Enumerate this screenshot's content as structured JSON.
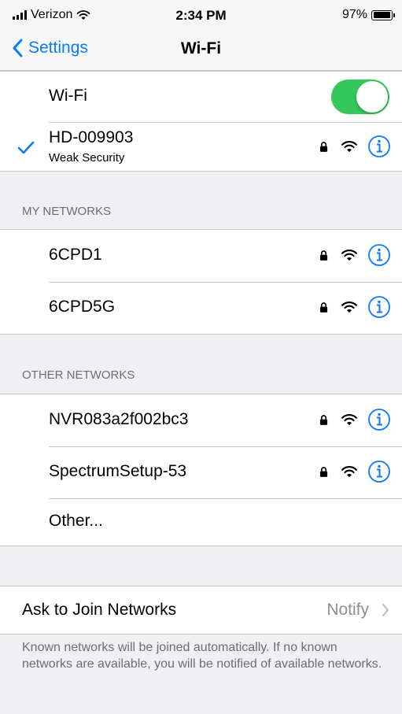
{
  "status_bar": {
    "carrier": "Verizon",
    "time": "2:34 PM",
    "battery": "97%"
  },
  "nav": {
    "back_label": "Settings",
    "title": "Wi-Fi"
  },
  "wifi_toggle": {
    "label": "Wi-Fi",
    "on": true
  },
  "connected": {
    "name": "HD-009903",
    "subtitle": "Weak Security"
  },
  "my_networks": {
    "header": "MY NETWORKS",
    "items": [
      {
        "name": "6CPD1"
      },
      {
        "name": "6CPD5G"
      }
    ]
  },
  "other_networks": {
    "header": "OTHER NETWORKS",
    "items": [
      {
        "name": "NVR083a2f002bc3"
      },
      {
        "name": "SpectrumSetup-53"
      }
    ],
    "other_label": "Other..."
  },
  "ask_to_join": {
    "label": "Ask to Join Networks",
    "value": "Notify",
    "footer": "Known networks will be joined automatically. If no known networks are available, you will be notified of available networks."
  },
  "colors": {
    "accent": "#0a7aff",
    "toggle_on": "#34c759",
    "background": "#efeff4",
    "secondary_text": "#6d6d72"
  },
  "icons": [
    "signal-icon",
    "wifi-icon",
    "battery-icon",
    "chevron-left-icon",
    "checkmark-icon",
    "lock-icon",
    "info-icon",
    "chevron-right-icon"
  ]
}
